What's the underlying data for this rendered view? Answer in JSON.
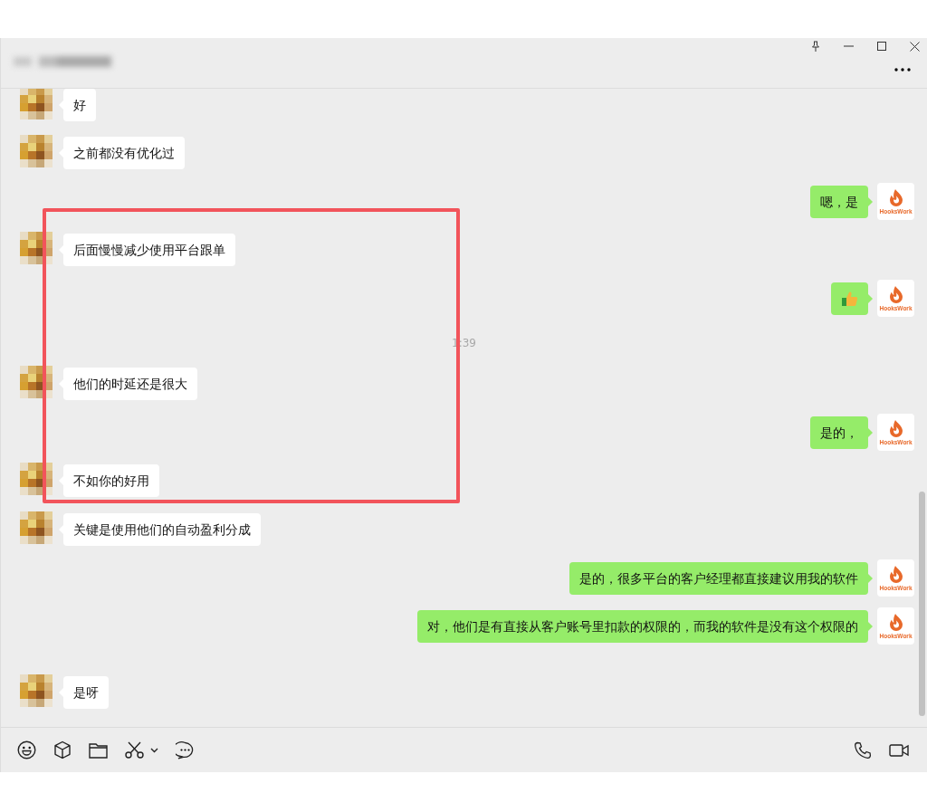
{
  "messages": [
    {
      "kind": "text",
      "outgoing": false,
      "text": "好"
    },
    {
      "kind": "text",
      "outgoing": false,
      "text": "之前都没有优化过"
    },
    {
      "kind": "text",
      "outgoing": true,
      "text": "嗯，是",
      "avatar_label": "HooksWork"
    },
    {
      "kind": "text",
      "outgoing": false,
      "text": "后面慢慢减少使用平台跟单"
    },
    {
      "kind": "emoji",
      "outgoing": true,
      "avatar_label": "HooksWork"
    },
    {
      "kind": "time",
      "text": "1:39"
    },
    {
      "kind": "text",
      "outgoing": false,
      "text": "他们的时延还是很大"
    },
    {
      "kind": "text",
      "outgoing": true,
      "text": "是的，",
      "avatar_label": "HooksWork"
    },
    {
      "kind": "text",
      "outgoing": false,
      "text": "不如你的好用"
    },
    {
      "kind": "text",
      "outgoing": false,
      "text": "关键是使用他们的自动盈利分成"
    },
    {
      "kind": "text",
      "outgoing": true,
      "text": "是的，很多平台的客户经理都直接建议用我的软件",
      "avatar_label": "HooksWork"
    },
    {
      "kind": "text",
      "outgoing": true,
      "text": "对，他们是有直接从客户账号里扣款的权限的，而我的软件是没有这个权限的",
      "avatar_label": "HooksWork"
    },
    {
      "kind": "text",
      "outgoing": false,
      "text": "是呀"
    }
  ],
  "annotation": {
    "kind": "rectangle"
  }
}
